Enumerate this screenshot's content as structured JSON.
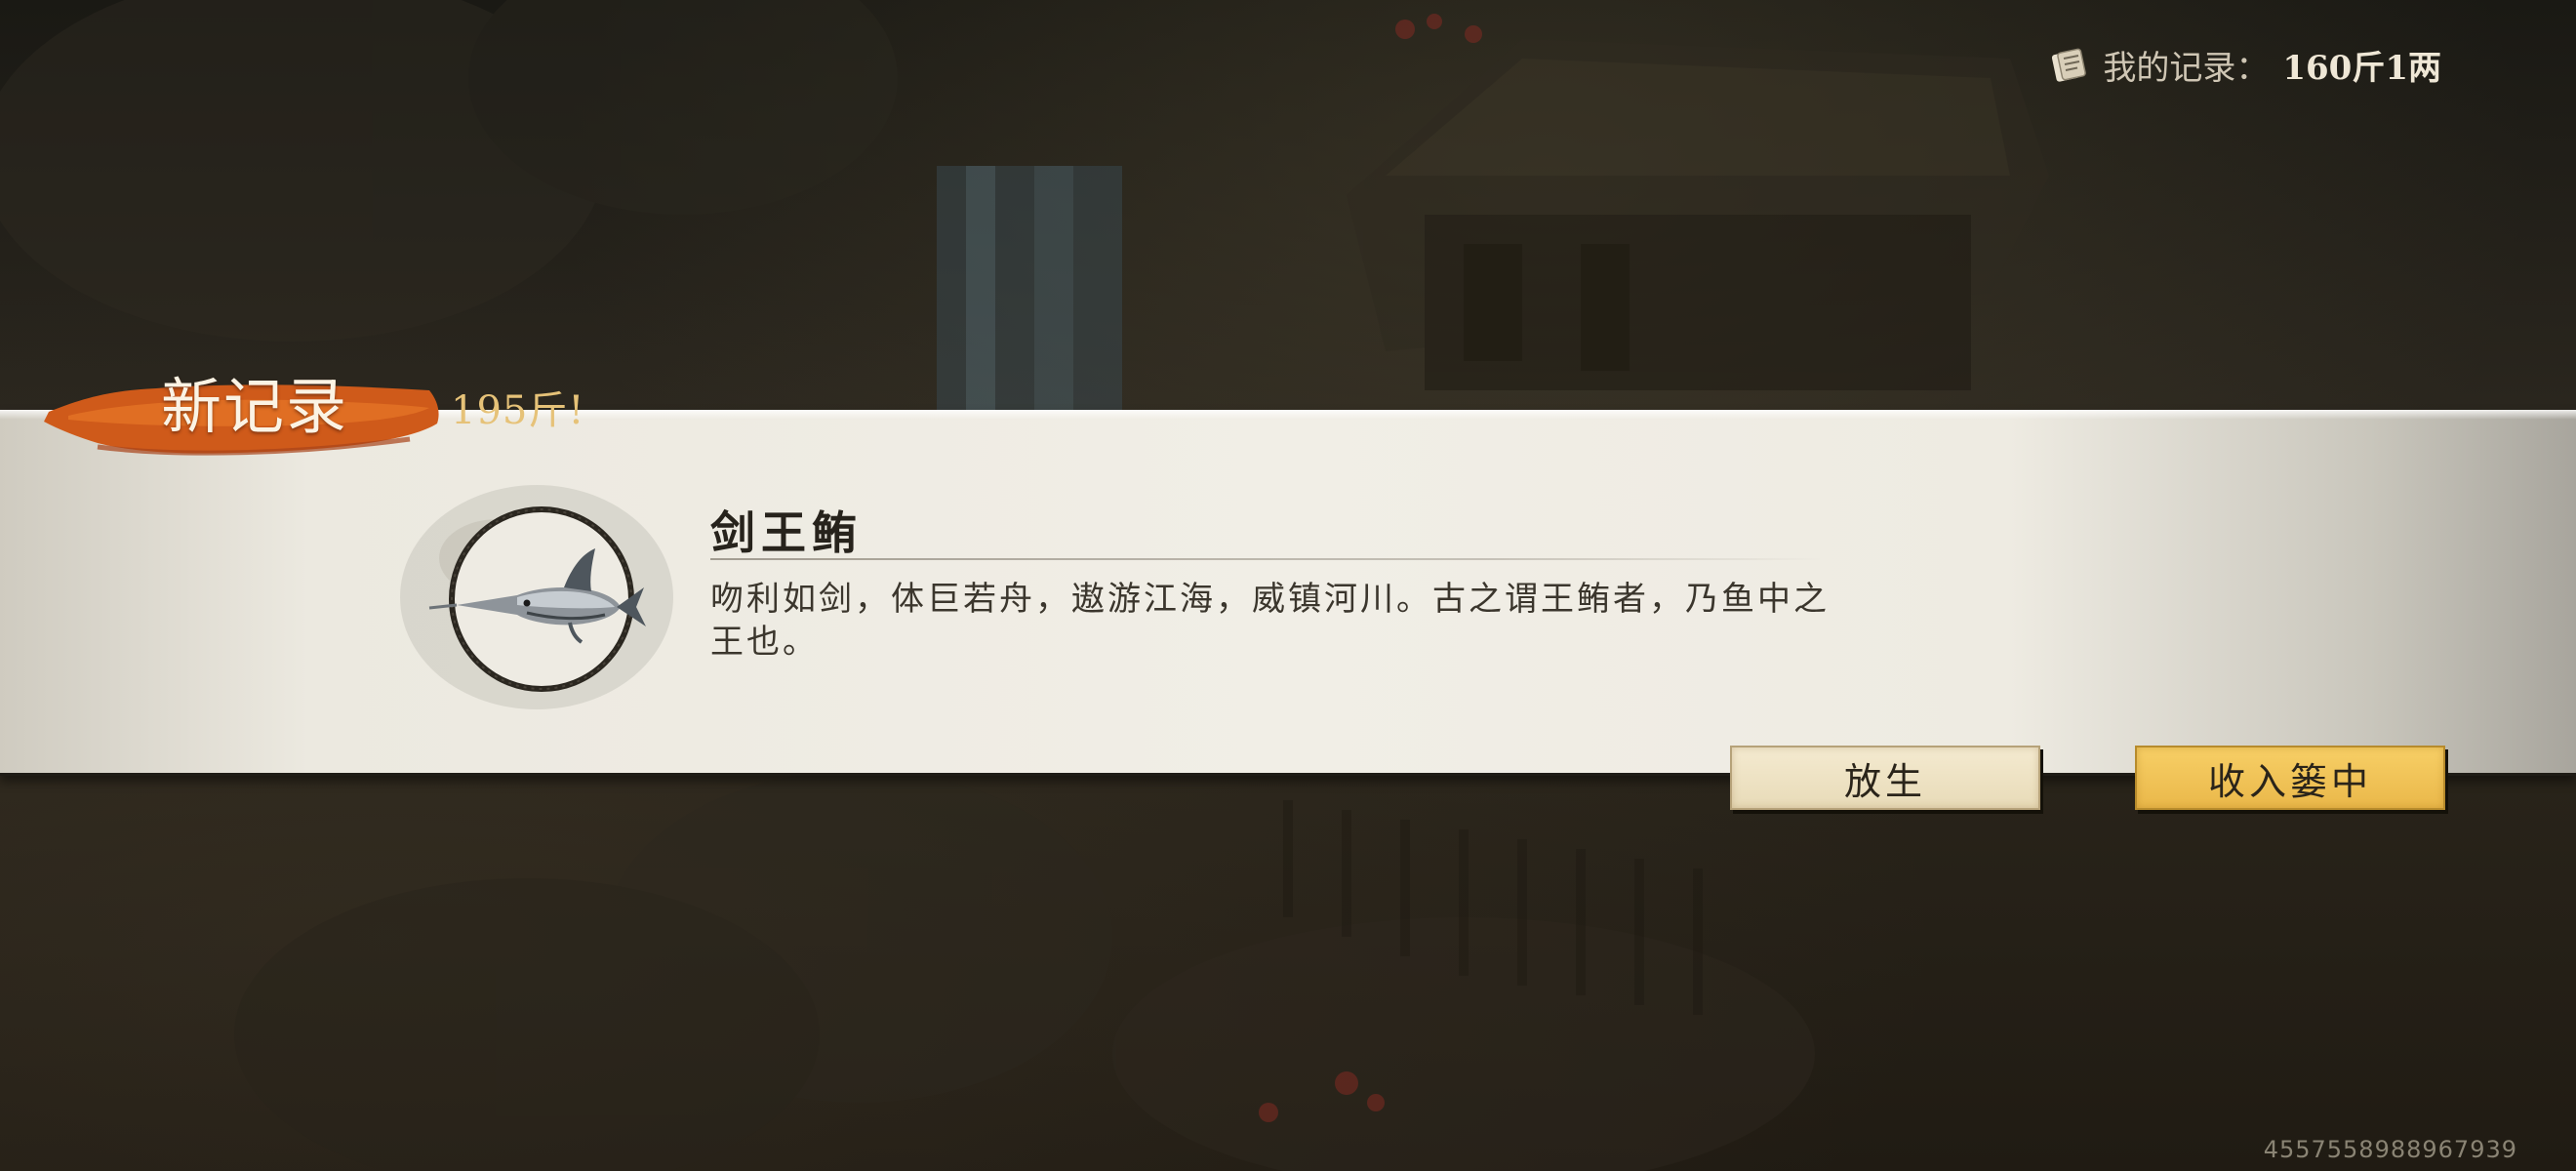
{
  "hud": {
    "record_label": "我的记录：",
    "record_value": "160斤1两",
    "record_icon": "scroll-icon"
  },
  "catch": {
    "new_record_label": "新记录",
    "new_record_weight": "195斤!",
    "fish_name": "剑王鲔",
    "fish_description": "吻利如剑，体巨若舟，遨游江海，威镇河川。古之谓王鲔者，乃鱼中之王也。",
    "fish_icon": "swordfish-icon"
  },
  "actions": {
    "release_label": "放生",
    "keep_label": "收入篓中"
  },
  "footer": {
    "player_id": "4557558988967939"
  },
  "colors": {
    "badge_orange": "#d2611f",
    "weight_gold": "#e6c278",
    "keep_button": "#f0c353",
    "release_button": "#efe4c6",
    "panel_paper": "#f1eee6"
  }
}
